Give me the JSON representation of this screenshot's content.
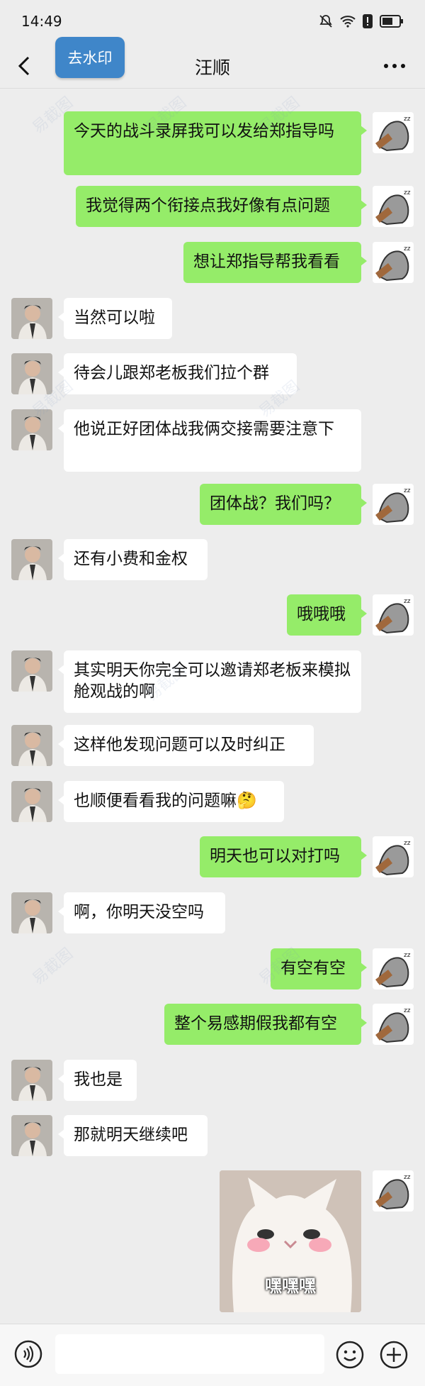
{
  "status": {
    "time": "14:49"
  },
  "header": {
    "title": "汪顺",
    "watermark_button": "去水印"
  },
  "messages": [
    {
      "side": "me",
      "text": "今天的战斗录屏我可以发给郑指导吗"
    },
    {
      "side": "me",
      "text": "我觉得两个衔接点我好像有点问题"
    },
    {
      "side": "me",
      "text": "想让郑指导帮我看看"
    },
    {
      "side": "other",
      "text": "当然可以啦"
    },
    {
      "side": "other",
      "text": "待会儿跟郑老板我们拉个群"
    },
    {
      "side": "other",
      "text": "他说正好团体战我俩交接需要注意下"
    },
    {
      "side": "me",
      "text": "团体战？我们吗？"
    },
    {
      "side": "other",
      "text": "还有小费和金权"
    },
    {
      "side": "me",
      "text": "哦哦哦"
    },
    {
      "side": "other",
      "text": "其实明天你完全可以邀请郑老板来模拟舱观战的啊"
    },
    {
      "side": "other",
      "text": "这样他发现问题可以及时纠正"
    },
    {
      "side": "other",
      "text": "也顺便看看我的问题嘛🤔"
    },
    {
      "side": "me",
      "text": "明天也可以对打吗"
    },
    {
      "side": "other",
      "text": "啊，你明天没空吗"
    },
    {
      "side": "me",
      "text": "有空有空"
    },
    {
      "side": "me",
      "text": "整个易感期假我都有空"
    },
    {
      "side": "other",
      "text": "我也是"
    },
    {
      "side": "other",
      "text": "那就明天继续吧"
    }
  ],
  "sticker": {
    "caption": "嘿嘿嘿"
  },
  "watermark_text": "易截图",
  "colors": {
    "my_bubble": "#95ec69",
    "other_bubble": "#ffffff",
    "background": "#ededed",
    "watermark_button": "#3f86c9"
  },
  "icons": [
    "back-icon",
    "more-icon",
    "voice-icon",
    "emoji-icon",
    "plus-icon",
    "wifi-icon",
    "battery-icon",
    "mute-icon"
  ]
}
